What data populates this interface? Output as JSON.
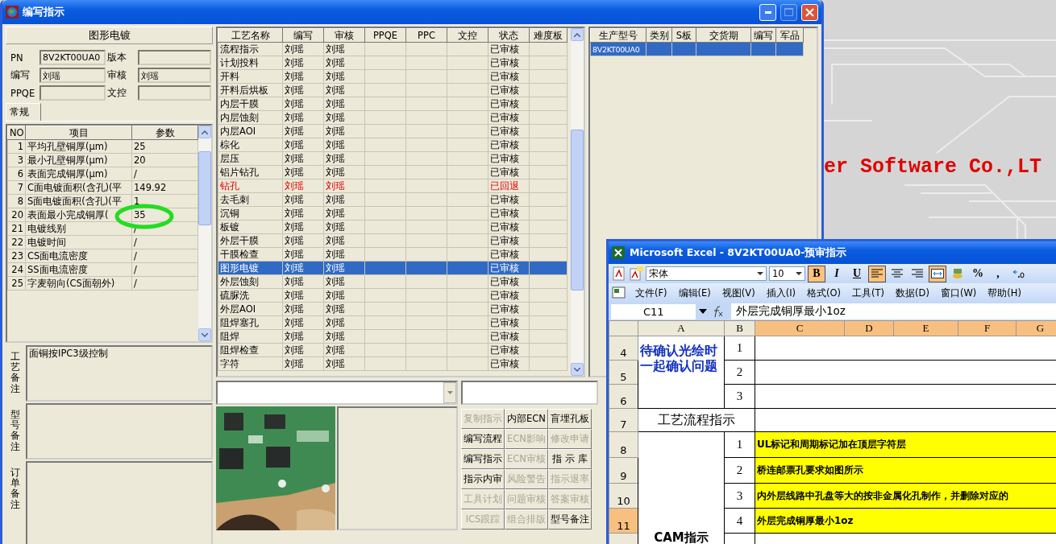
{
  "main_window": {
    "title": "编写指示",
    "maximize_disabled": true,
    "process_title": "图形电镀",
    "fields": [
      {
        "label": "PN",
        "value": "8V2KT00UA0"
      },
      {
        "label": "版本"
      },
      {
        "label": "编写",
        "value": "刘瑶"
      },
      {
        "label": "审核",
        "value": "刘瑶"
      },
      {
        "label": "PPQE"
      },
      {
        "label": "文控"
      }
    ],
    "tabs": [
      {
        "label": "常规",
        "selected": true
      }
    ],
    "params": {
      "columns": [
        "NO",
        "项目",
        "参数"
      ],
      "rows": [
        {
          "no": "1",
          "item": "平均孔壁铜厚(μm)",
          "value": "25"
        },
        {
          "no": "3",
          "item": "最小孔壁铜厚(μm)",
          "value": "20"
        },
        {
          "no": "6",
          "item": "表面完成铜厚(μm)",
          "value": "/"
        },
        {
          "no": "7",
          "item": "C面电镀面积(含孔)(平",
          "value": "149.92"
        },
        {
          "no": "8",
          "item": "S面电镀面积(含孔)(平",
          "value": "1"
        },
        {
          "no": "20",
          "item": "表面最小完成铜厚(",
          "value": "35"
        },
        {
          "no": "21",
          "item": "电镀线别",
          "value": "/"
        },
        {
          "no": "22",
          "item": "电镀时间",
          "value": "/"
        },
        {
          "no": "23",
          "item": "CS面电流密度",
          "value": "/"
        },
        {
          "no": "24",
          "item": "SS面电流密度",
          "value": "/"
        },
        {
          "no": "25",
          "item": "字麦朝向(CS面朝外)",
          "value": "/"
        }
      ]
    },
    "notes": [
      {
        "label": "工艺备注",
        "text": "面铜按IPC3级控制"
      },
      {
        "label": "型号备注"
      },
      {
        "label": "订单备注"
      }
    ],
    "process_table": {
      "columns": [
        "工艺名称",
        "编写",
        "审核",
        "PPQE",
        "PPC",
        "文控",
        "状态",
        "难度板"
      ],
      "rows": [
        {
          "name": "流程指示",
          "writer": "刘瑶",
          "reviewer": "刘瑶",
          "status": "已审核",
          "returned": false,
          "selected": false
        },
        {
          "name": "计划投料",
          "writer": "刘瑶",
          "reviewer": "刘瑶",
          "status": "已审核",
          "returned": false,
          "selected": false
        },
        {
          "name": "开料",
          "writer": "刘瑶",
          "reviewer": "刘瑶",
          "status": "已审核",
          "returned": false,
          "selected": false
        },
        {
          "name": "开料后烘板",
          "writer": "刘瑶",
          "reviewer": "刘瑶",
          "status": "已审核",
          "returned": false,
          "selected": false
        },
        {
          "name": "内层干膜",
          "writer": "刘瑶",
          "reviewer": "刘瑶",
          "status": "已审核",
          "returned": false,
          "selected": false
        },
        {
          "name": "内层蚀刻",
          "writer": "刘瑶",
          "reviewer": "刘瑶",
          "status": "已审核",
          "returned": false,
          "selected": false
        },
        {
          "name": "内层AOI",
          "writer": "刘瑶",
          "reviewer": "刘瑶",
          "status": "已审核",
          "returned": false,
          "selected": false
        },
        {
          "name": "棕化",
          "writer": "刘瑶",
          "reviewer": "刘瑶",
          "status": "已审核",
          "returned": false,
          "selected": false
        },
        {
          "name": "层压",
          "writer": "刘瑶",
          "reviewer": "刘瑶",
          "status": "已审核",
          "returned": false,
          "selected": false
        },
        {
          "name": "铝片钻孔",
          "writer": "刘瑶",
          "reviewer": "刘瑶",
          "status": "已审核",
          "returned": false,
          "selected": false
        },
        {
          "name": "钻孔",
          "writer": "刘瑶",
          "reviewer": "刘瑶",
          "status": "已回退",
          "returned": true,
          "selected": false
        },
        {
          "name": "去毛刺",
          "writer": "刘瑶",
          "reviewer": "刘瑶",
          "status": "已审核",
          "returned": false,
          "selected": false
        },
        {
          "name": "沉铜",
          "writer": "刘瑶",
          "reviewer": "刘瑶",
          "status": "已审核",
          "returned": false,
          "selected": false
        },
        {
          "name": "板镀",
          "writer": "刘瑶",
          "reviewer": "刘瑶",
          "status": "已审核",
          "returned": false,
          "selected": false
        },
        {
          "name": "外层干膜",
          "writer": "刘瑶",
          "reviewer": "刘瑶",
          "status": "已审核",
          "returned": false,
          "selected": false
        },
        {
          "name": "干膜检查",
          "writer": "刘瑶",
          "reviewer": "刘瑶",
          "status": "已审核",
          "returned": false,
          "selected": false
        },
        {
          "name": "图形电镀",
          "writer": "刘瑶",
          "reviewer": "刘瑶",
          "status": "已审核",
          "returned": false,
          "selected": true
        },
        {
          "name": "外层蚀刻",
          "writer": "刘瑶",
          "reviewer": "刘瑶",
          "status": "已审核",
          "returned": false,
          "selected": false
        },
        {
          "name": "硫脲洗",
          "writer": "刘瑶",
          "reviewer": "刘瑶",
          "status": "已审核",
          "returned": false,
          "selected": false
        },
        {
          "name": "外层AOI",
          "writer": "刘瑶",
          "reviewer": "刘瑶",
          "status": "已审核",
          "returned": false,
          "selected": false
        },
        {
          "name": "阻焊塞孔",
          "writer": "刘瑶",
          "reviewer": "刘瑶",
          "status": "已审核",
          "returned": false,
          "selected": false
        },
        {
          "name": "阻焊",
          "writer": "刘瑶",
          "reviewer": "刘瑶",
          "status": "已审核",
          "returned": false,
          "selected": false
        },
        {
          "name": "阻焊检查",
          "writer": "刘瑶",
          "reviewer": "刘瑶",
          "status": "已审核",
          "returned": false,
          "selected": false
        },
        {
          "name": "字符",
          "writer": "刘瑶",
          "reviewer": "刘瑶",
          "status": "已审核",
          "returned": false,
          "selected": false
        }
      ]
    },
    "model_table": {
      "columns": [
        "生产型号",
        "类别",
        "S板",
        "交货期",
        "编写",
        "军品"
      ],
      "rows": [
        {
          "model": "8V2KT00UA0",
          "selected": true
        }
      ]
    },
    "buttons": [
      {
        "label": "复制指示",
        "disabled": true
      },
      {
        "label": "内部ECN",
        "disabled": false
      },
      {
        "label": "盲埋孔板",
        "disabled": false
      },
      {
        "label": "编写流程",
        "disabled": false
      },
      {
        "label": "ECN影响",
        "disabled": true
      },
      {
        "label": "修改申请",
        "disabled": true
      },
      {
        "label": "编写指示",
        "disabled": false
      },
      {
        "label": "ECN审核",
        "disabled": true
      },
      {
        "label": "指 示 库",
        "disabled": false
      },
      {
        "label": "指示内审",
        "disabled": false
      },
      {
        "label": "风险警告",
        "disabled": true
      },
      {
        "label": "指示退率",
        "disabled": true
      },
      {
        "label": "工具计划",
        "disabled": true
      },
      {
        "label": "问题审核",
        "disabled": true
      },
      {
        "label": "答案审核",
        "disabled": true
      },
      {
        "label": "ICS跟踪",
        "disabled": true
      },
      {
        "label": "组合排版",
        "disabled": true
      },
      {
        "label": "型号备注",
        "disabled": false
      }
    ]
  },
  "desktop_text": "er Software Co.,LT",
  "excel": {
    "title": "Microsoft Excel - 8V2KT00UA0-预审指示",
    "font": "宋体",
    "size": "10",
    "format_buttons": [
      {
        "kind": "text",
        "label": "B",
        "on": true
      },
      {
        "kind": "text",
        "label": "I",
        "on": false
      },
      {
        "kind": "text",
        "label": "U",
        "on": false
      },
      {
        "kind": "align-left",
        "on": true
      },
      {
        "kind": "align-center",
        "on": false
      },
      {
        "kind": "align-right",
        "on": false
      },
      {
        "kind": "merge",
        "on": true
      },
      {
        "kind": "currency",
        "on": false
      },
      {
        "kind": "text",
        "label": "%",
        "on": false
      },
      {
        "kind": "text",
        "label": ",",
        "on": false
      },
      {
        "kind": "decimal",
        "on": false
      }
    ],
    "menu": [
      "文件(F)",
      "编辑(E)",
      "视图(V)",
      "插入(I)",
      "格式(O)",
      "工具(T)",
      "数据(D)",
      "窗口(W)",
      "帮助(H)"
    ],
    "name_box": "C11",
    "formula": "外层完成铜厚最小1oz",
    "columns": [
      {
        "label": "A",
        "selected": false
      },
      {
        "label": "B",
        "selected": false
      },
      {
        "label": "C",
        "selected": true
      },
      {
        "label": "D",
        "selected": true
      },
      {
        "label": "E",
        "selected": true
      },
      {
        "label": "F",
        "selected": true
      },
      {
        "label": "G",
        "selected": true
      }
    ],
    "blocks": [
      {
        "kind": "pending",
        "label": "待确认光绘时一起确认问题",
        "rows": [
          {
            "num": "4",
            "index": "1",
            "selected": false
          },
          {
            "num": "5",
            "index": "2",
            "selected": false
          },
          {
            "num": "6",
            "index": "3",
            "selected": false
          }
        ]
      },
      {
        "kind": "section",
        "label": "工艺流程指示",
        "rows": [
          {
            "num": "7",
            "selected": false
          }
        ]
      },
      {
        "kind": "cam",
        "label": "CAM指示",
        "rows": [
          {
            "num": "8",
            "index": "1",
            "text": "UL标记和周期标记加在顶层字符层",
            "selected": false
          },
          {
            "num": "9",
            "index": "2",
            "text": "桥连邮票孔要求如图所示",
            "selected": false
          },
          {
            "num": "10",
            "index": "3",
            "text": "内外层线路中孔盘等大的按非金属化孔制作，并删除对应的",
            "selected": false
          },
          {
            "num": "11",
            "index": "4",
            "text": "外层完成铜厚最小1oz",
            "selected": true
          }
        ]
      }
    ]
  }
}
